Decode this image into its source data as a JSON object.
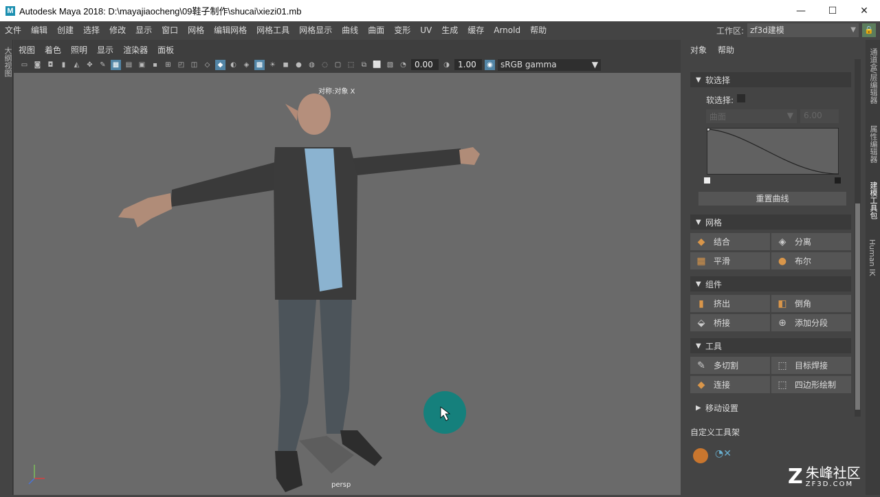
{
  "app": {
    "logo": "M",
    "title": "Autodesk Maya 2018: D:\\mayajiaocheng\\09鞋子制作\\shucai\\xiezi01.mb"
  },
  "window_controls": {
    "minimize": "—",
    "maximize": "☐",
    "close": "✕"
  },
  "menu": [
    "文件",
    "编辑",
    "创建",
    "选择",
    "修改",
    "显示",
    "窗口",
    "网格",
    "编辑网格",
    "网格工具",
    "网格显示",
    "曲线",
    "曲面",
    "变形",
    "UV",
    "生成",
    "缓存",
    "Arnold",
    "帮助"
  ],
  "workspace": {
    "label": "工作区:",
    "value": "zf3d建模"
  },
  "left_tab": "大纲视图",
  "viewport_menu": [
    "视图",
    "着色",
    "照明",
    "显示",
    "渲染器",
    "面板"
  ],
  "viewport_toolbar": {
    "value1": "0.00",
    "value2": "1.00",
    "color_space": "sRGB gamma"
  },
  "viewport": {
    "symmetry_label": "对称:对象 X",
    "camera": "persp",
    "bg_color": "#6a6a6a"
  },
  "right_panel": {
    "menu": [
      "对象",
      "帮助"
    ],
    "soft_select": {
      "header": "软选择",
      "label": "软选择:",
      "dropdown": "曲面",
      "value": "6.00",
      "reset": "重置曲线"
    },
    "mesh": {
      "header": "网格",
      "buttons": [
        "结合",
        "分离",
        "平滑",
        "布尔"
      ]
    },
    "components": {
      "header": "组件",
      "buttons": [
        "挤出",
        "倒角",
        "桥接",
        "添加分段"
      ]
    },
    "tools": {
      "header": "工具",
      "buttons": [
        "多切割",
        "目标焊接",
        "连接",
        "四边形绘制"
      ]
    },
    "move_settings": "移动设置",
    "shelf": "自定义工具架"
  },
  "right_tabs": [
    "通道盒/层编辑器",
    "属性编辑器",
    "建模工具包",
    "Human IK"
  ],
  "watermark": {
    "text": "朱峰社区",
    "url": "ZF3D.COM"
  }
}
